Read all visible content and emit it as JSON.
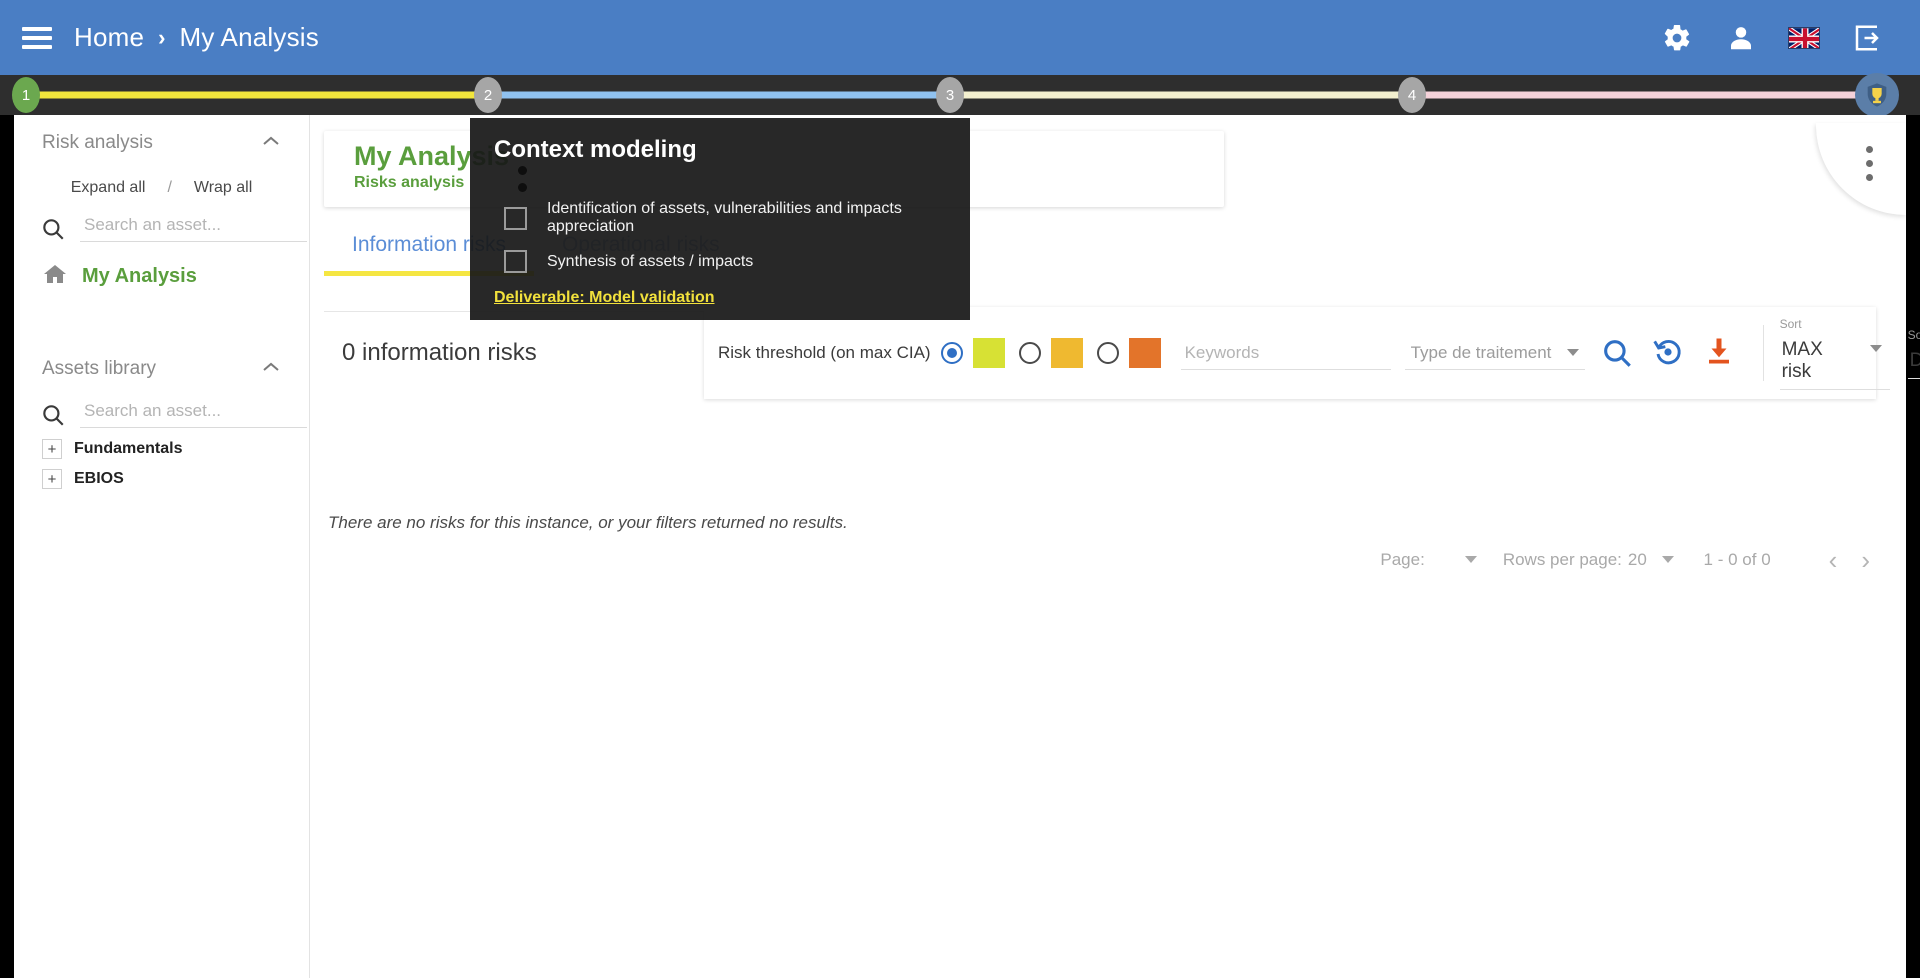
{
  "header": {
    "menu_icon": "hamburger-icon",
    "breadcrumb": {
      "home": "Home",
      "separator": "›",
      "current": "My Analysis"
    },
    "icons": [
      {
        "name": "settings-gear-icon",
        "label": "Settings"
      },
      {
        "name": "user-account-icon",
        "label": "Account"
      },
      {
        "name": "uk-flag-icon",
        "label": "English"
      },
      {
        "name": "logout-icon",
        "label": "Logout"
      }
    ],
    "accent_blue": "#4a7ec4"
  },
  "stepper": {
    "steps": [
      {
        "number": "1",
        "state": "active",
        "color": "#6ba84f"
      },
      {
        "number": "2",
        "state": "inactive",
        "color": "#a6a6a6"
      },
      {
        "number": "3",
        "state": "inactive",
        "color": "#a6a6a6"
      },
      {
        "number": "4",
        "state": "inactive",
        "color": "#a6a6a6"
      }
    ],
    "connectors": [
      {
        "from": "1",
        "to": "2",
        "color": "#f2e63c"
      },
      {
        "from": "2",
        "to": "3",
        "color": "#90c2f0"
      },
      {
        "from": "3",
        "to": "4",
        "color": "#f3f0cf"
      },
      {
        "from": "4",
        "to": "end",
        "color": "#f5d2da"
      }
    ],
    "final_node": {
      "name": "shield-trophy-icon",
      "color": "#5b7ea8"
    },
    "track_color": "#2e2e2e"
  },
  "tooltip": {
    "title": "Context modeling",
    "items": [
      {
        "label": "Identification of assets, vulnerabilities and impacts appreciation",
        "checked": false
      },
      {
        "label": "Synthesis of assets / impacts",
        "checked": false
      }
    ],
    "deliverable": "Deliverable: Model validation",
    "deliverable_color": "#f2e13c"
  },
  "sidebar": {
    "risk_analysis": {
      "title": "Risk analysis",
      "collapse_icon": "chevron-up-icon",
      "expand_all": "Expand all",
      "separator": "/",
      "wrap_all": "Wrap all",
      "search_placeholder": "Search an asset...",
      "search_value": "",
      "root_item": "My Analysis",
      "root_icon": "home-icon"
    },
    "assets_library": {
      "title": "Assets library",
      "collapse_icon": "chevron-up-icon",
      "search_placeholder": "Search an asset...",
      "search_value": "",
      "add_icon": "add-document-icon",
      "items": [
        {
          "label": "Fundamentals",
          "expander": "+"
        },
        {
          "label": "EBIOS",
          "expander": "+"
        }
      ]
    }
  },
  "content": {
    "analysis_title": "My Analysis",
    "analysis_subtitle": "Risks analysis",
    "tabs": [
      {
        "label": "Information risks",
        "active": true
      },
      {
        "label": "Operational risks",
        "active": false
      }
    ],
    "kebab_icon": "more-vertical-icon",
    "risk_count": "0 information risks",
    "empty_message": "There are no risks for this instance, or your filters returned no results.",
    "filters": {
      "threshold_label": "Risk threshold (on max CIA)",
      "thresholds": [
        {
          "selected": true,
          "color": "#d7e134"
        },
        {
          "selected": false,
          "color": "#efb930"
        },
        {
          "selected": false,
          "color": "#e3742a"
        }
      ],
      "keywords_placeholder": "Keywords",
      "keywords_value": "",
      "treatment_placeholder": "Type de traitement",
      "treatment_value": "",
      "search_icon": "search-icon",
      "reset_icon": "reset-history-icon",
      "download_icon": "download-icon",
      "sort_label": "Sort",
      "sort_value": "MAX risk",
      "sort_direction_label": "Sort direction",
      "sort_direction_value": "Descending"
    },
    "pagination": {
      "page_label": "Page:",
      "page_value": "",
      "rows_label": "Rows per page:",
      "rows_value": "20",
      "range": "1 - 0 of 0",
      "prev_icon": "chevron-left-icon",
      "next_icon": "chevron-right-icon"
    }
  }
}
